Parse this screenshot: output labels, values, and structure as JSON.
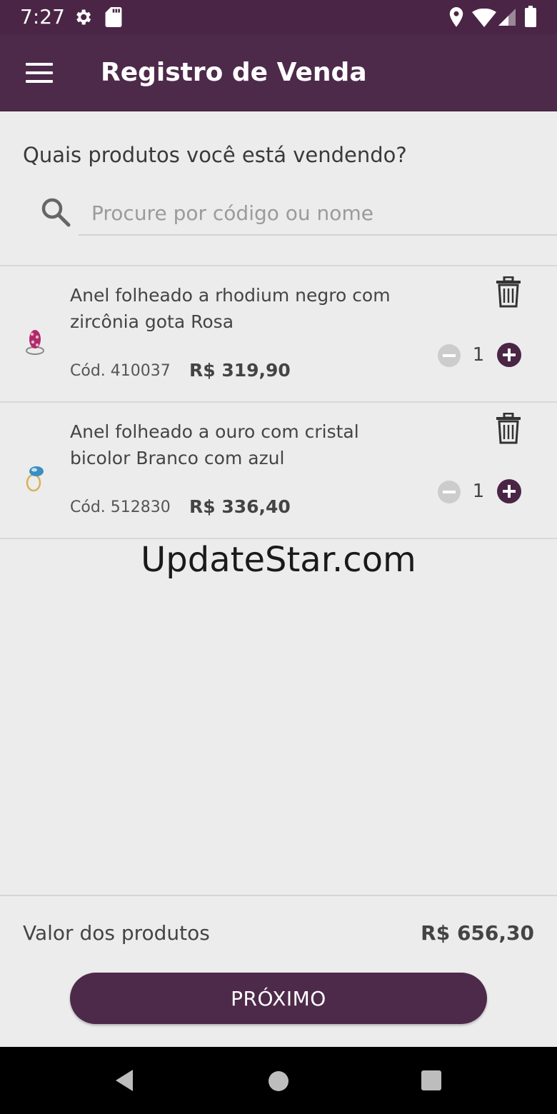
{
  "status_bar": {
    "time": "7:27",
    "icons": [
      "gear-icon",
      "sd-card-icon",
      "location-icon",
      "wifi-icon",
      "signal-icon",
      "battery-icon"
    ]
  },
  "app_bar": {
    "title": "Registro de Venda",
    "menu_icon": "hamburger-menu-icon"
  },
  "main": {
    "question": "Quais produtos você está vendendo?",
    "search": {
      "placeholder": "Procure por código ou nome",
      "value": ""
    },
    "products": [
      {
        "name": "Anel folheado a rhodium negro com zircônia gota Rosa",
        "code": "Cód. 410037",
        "price": "R$ 319,90",
        "quantity": "1"
      },
      {
        "name": "Anel folheado a ouro com cristal bicolor Branco com azul",
        "code": "Cód. 512830",
        "price": "R$ 336,40",
        "quantity": "1"
      }
    ],
    "watermark": "UpdateStar.com"
  },
  "footer": {
    "total_label": "Valor dos produtos",
    "total_value": "R$ 656,30",
    "next_label": "PRÓXIMO"
  },
  "colors": {
    "primary": "#4d2a4a",
    "status_bar": "#4a2545",
    "background": "#ececec",
    "disabled_minus": "#cccccc"
  }
}
